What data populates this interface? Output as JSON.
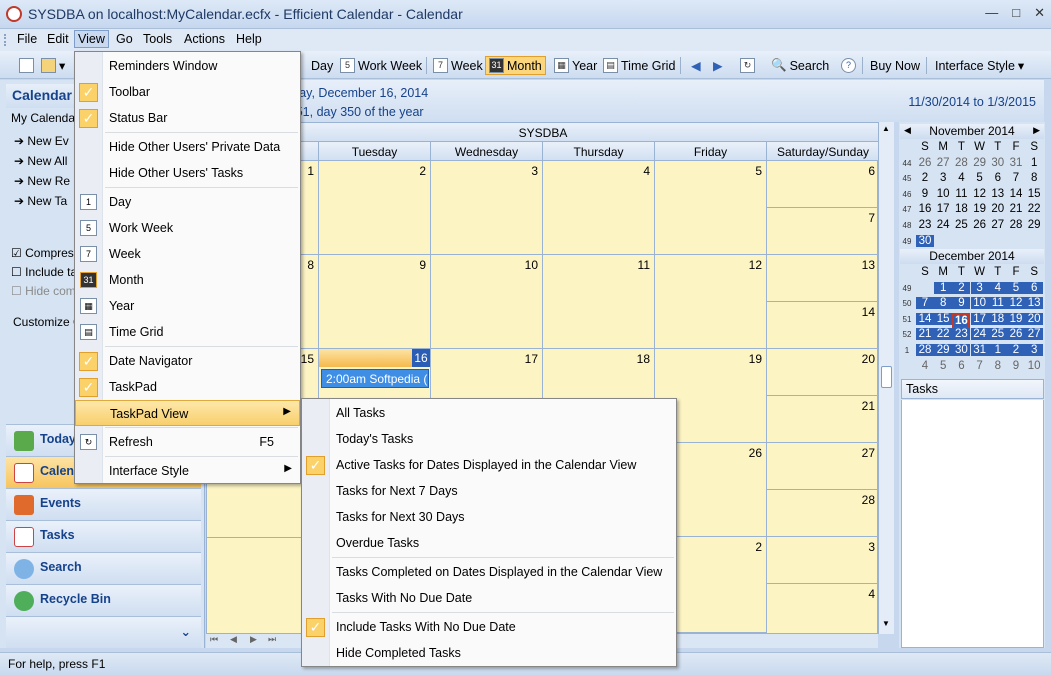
{
  "window": {
    "title": "SYSDBA on localhost:MyCalendar.ecfx - Efficient Calendar - Calendar"
  },
  "menubar": [
    "File",
    "Edit",
    "View",
    "Go",
    "Tools",
    "Actions",
    "Help"
  ],
  "toolbar": {
    "day": "Day",
    "work_week": "Work Week",
    "week": "Week",
    "month": "Month",
    "year": "Year",
    "time_grid": "Time Grid",
    "search": "Search",
    "buy_now": "Buy Now",
    "interface_style": "Interface Style"
  },
  "left": {
    "header": "Calendar",
    "my_calendar": "My Calendar",
    "links": [
      "New Ev",
      "New All",
      "New Re",
      "New Ta"
    ],
    "checks": [
      "Compress",
      "Include ta",
      "Hide com"
    ],
    "customize": "Customize C",
    "nav": [
      "Today",
      "Calen",
      "Events",
      "Tasks",
      "Search",
      "Recycle Bin"
    ]
  },
  "main": {
    "date_line": "sday, December 16, 2014",
    "week_line": "k 51, day 350 of the year",
    "range": "11/30/2014 to 1/3/2015",
    "owner": "SYSDBA",
    "days": [
      "Tuesday",
      "Wednesday",
      "Thursday",
      "Friday",
      "Saturday/Sunday"
    ],
    "appointment": "2:00am Softpedia (I"
  },
  "minical": {
    "nov_title": "November 2014",
    "dec_title": "December 2014",
    "dow": [
      "S",
      "M",
      "T",
      "W",
      "T",
      "F",
      "S"
    ],
    "nov_weeks": [
      "44",
      "45",
      "46",
      "47",
      "48",
      "49"
    ],
    "nov_rows": [
      [
        "26",
        "27",
        "28",
        "29",
        "30",
        "31",
        "1"
      ],
      [
        "2",
        "3",
        "4",
        "5",
        "6",
        "7",
        "8"
      ],
      [
        "9",
        "10",
        "11",
        "12",
        "13",
        "14",
        "15"
      ],
      [
        "16",
        "17",
        "18",
        "19",
        "20",
        "21",
        "22"
      ],
      [
        "23",
        "24",
        "25",
        "26",
        "27",
        "28",
        "29"
      ],
      [
        "30",
        "",
        "",
        "",
        "",
        "",
        ""
      ]
    ],
    "dec_weeks": [
      "49",
      "50",
      "51",
      "52",
      "1",
      ""
    ],
    "dec_rows": [
      [
        "",
        "1",
        "2",
        "3",
        "4",
        "5",
        "6"
      ],
      [
        "7",
        "8",
        "9",
        "10",
        "11",
        "12",
        "13"
      ],
      [
        "14",
        "15",
        "16",
        "17",
        "18",
        "19",
        "20"
      ],
      [
        "21",
        "22",
        "23",
        "24",
        "25",
        "26",
        "27"
      ],
      [
        "28",
        "29",
        "30",
        "31",
        "1",
        "2",
        "3"
      ],
      [
        "4",
        "5",
        "6",
        "7",
        "8",
        "9",
        "10"
      ]
    ]
  },
  "tasks_label": "Tasks",
  "status": "For help, press F1",
  "view_menu": [
    "Reminders Window",
    "Toolbar",
    "Status Bar",
    "Hide Other Users' Private Data",
    "Hide Other Users' Tasks",
    "Day",
    "Work Week",
    "Week",
    "Month",
    "Year",
    "Time Grid",
    "Date Navigator",
    "TaskPad",
    "TaskPad View",
    "Refresh",
    "Interface Style"
  ],
  "refresh_shortcut": "F5",
  "taskpad_menu": [
    "All Tasks",
    "Today's Tasks",
    "Active Tasks for Dates Displayed in the Calendar View",
    "Tasks for Next 7 Days",
    "Tasks for Next 30 Days",
    "Overdue Tasks",
    "Tasks Completed on Dates Displayed in the Calendar View",
    "Tasks With No Due Date",
    "Include Tasks With No Due Date",
    "Hide Completed Tasks"
  ],
  "cal_numbers": {
    "r1": [
      "1",
      "2",
      "3",
      "4",
      "5",
      "6",
      "7"
    ],
    "r2": [
      "8",
      "9",
      "10",
      "11",
      "12",
      "13",
      "14"
    ],
    "r3": [
      "15",
      "16",
      "17",
      "18",
      "19",
      "20",
      "21"
    ],
    "r4": [
      "26",
      "27",
      "28"
    ],
    "r5": [
      "2",
      "3",
      "4"
    ]
  },
  "colors": {
    "accent": "#2f62b6",
    "highlight": "#fbd16a",
    "cell": "#fdf4c4"
  }
}
